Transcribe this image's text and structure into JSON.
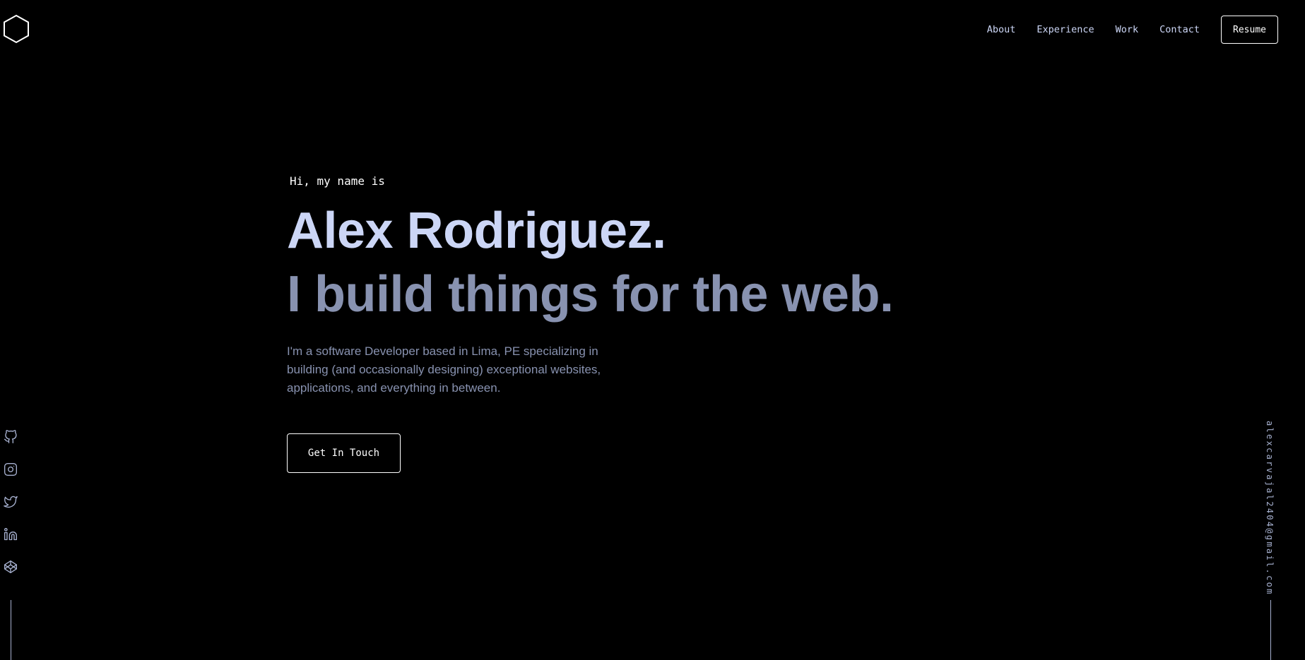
{
  "header": {
    "logo_icon": "hexagon-logo-icon",
    "nav": [
      {
        "label": "About"
      },
      {
        "label": "Experience"
      },
      {
        "label": "Work"
      },
      {
        "label": "Contact"
      }
    ],
    "resume_label": "Resume"
  },
  "hero": {
    "greeting": "Hi, my name is",
    "name": "Alex Rodriguez.",
    "tagline": "I build things for the web.",
    "description": "I'm a software Developer based in Lima, PE specializing in building (and occasionally designing) exceptional websites, applications, and everything in between.",
    "cta_label": "Get In Touch"
  },
  "social": [
    {
      "icon": "github-icon"
    },
    {
      "icon": "instagram-icon"
    },
    {
      "icon": "twitter-icon"
    },
    {
      "icon": "linkedin-icon"
    },
    {
      "icon": "codepen-icon"
    }
  ],
  "email": "alexcarvajal2404@gmail.com",
  "colors": {
    "background": "#000000",
    "heading": "#ccd6f6",
    "muted": "#8892b0",
    "light": "#a8b2d1",
    "white": "#ffffff"
  }
}
